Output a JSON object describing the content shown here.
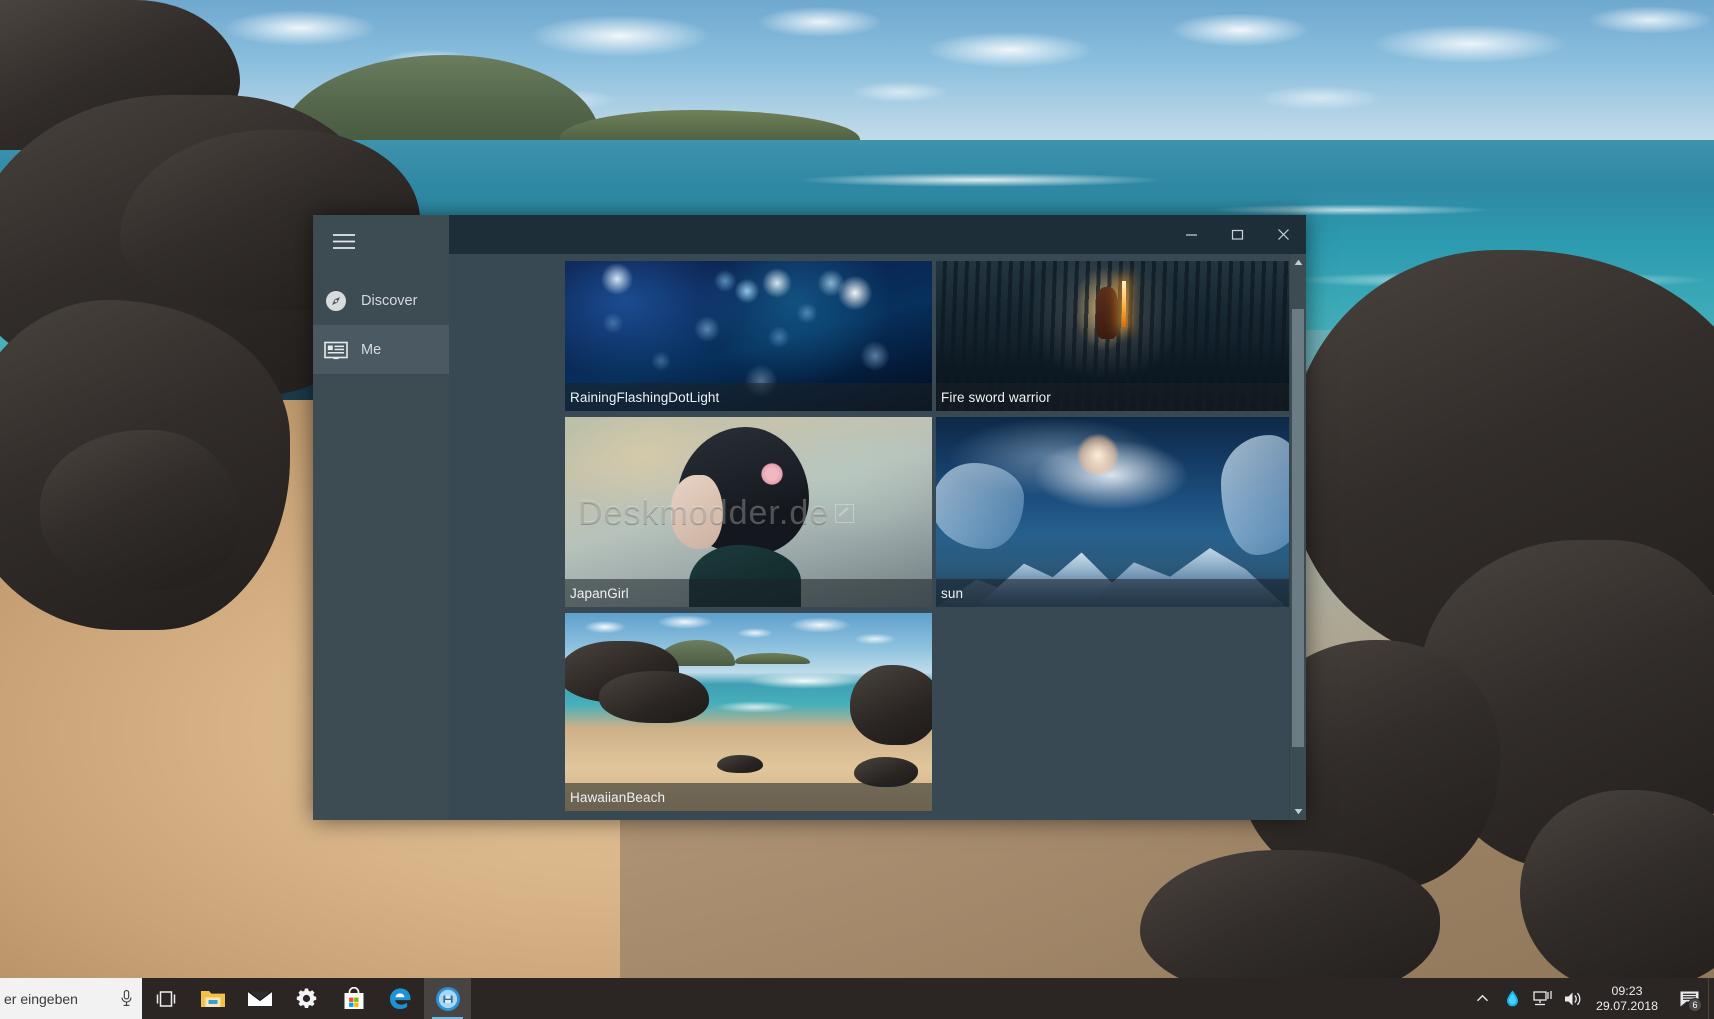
{
  "window": {
    "title": "",
    "controls": {
      "minimize": "minimize",
      "maximize": "maximize",
      "close": "close"
    }
  },
  "sidebar": {
    "hamburger_label": "Menu",
    "items": [
      {
        "label": "Discover",
        "icon": "compass-icon",
        "active": false
      },
      {
        "label": "Me",
        "icon": "cards-icon",
        "active": true
      }
    ]
  },
  "gallery": {
    "watermark": "Deskmodder.de",
    "tiles": [
      {
        "label": "RainingFlashingDotLight",
        "selected": false
      },
      {
        "label": "Fire sword warrior",
        "selected": false
      },
      {
        "label": "JapanGirl",
        "selected": false
      },
      {
        "label": "sun",
        "selected": false
      },
      {
        "label": "HawaiianBeach",
        "selected": true
      }
    ]
  },
  "scrollbar": {
    "up_arrow": "▲",
    "down_arrow": "▼"
  },
  "taskbar": {
    "search_text": "er eingeben",
    "search_placeholder": "Zur Suche Text hier eingeben",
    "mic_icon": "microphone-icon",
    "buttons": [
      {
        "name": "task-view",
        "label": "Task View"
      },
      {
        "name": "file-explorer",
        "label": "Explorer"
      },
      {
        "name": "mail",
        "label": "Mail"
      },
      {
        "name": "settings",
        "label": "Einstellungen"
      },
      {
        "name": "microsoft-store",
        "label": "Microsoft Store"
      },
      {
        "name": "edge",
        "label": "Microsoft Edge"
      },
      {
        "name": "wallpaper-app",
        "label": "Wallpaper App"
      }
    ],
    "tray": {
      "chevron": "Ausgeblendete Symbole einblenden",
      "flux": "f.lux",
      "network": "Netzwerk",
      "volume": "Lautstärke",
      "time": "09:23",
      "date": "29.07.2018",
      "notification_count": "6"
    }
  },
  "colors": {
    "window_bg": "#394953",
    "sidebar_bg": "#3d4b53",
    "sidebar_active": "#4b5a62",
    "titlebar_bg": "#1e2e38",
    "selection": "#77a8ac",
    "taskbar_bg": "#2b2623"
  }
}
